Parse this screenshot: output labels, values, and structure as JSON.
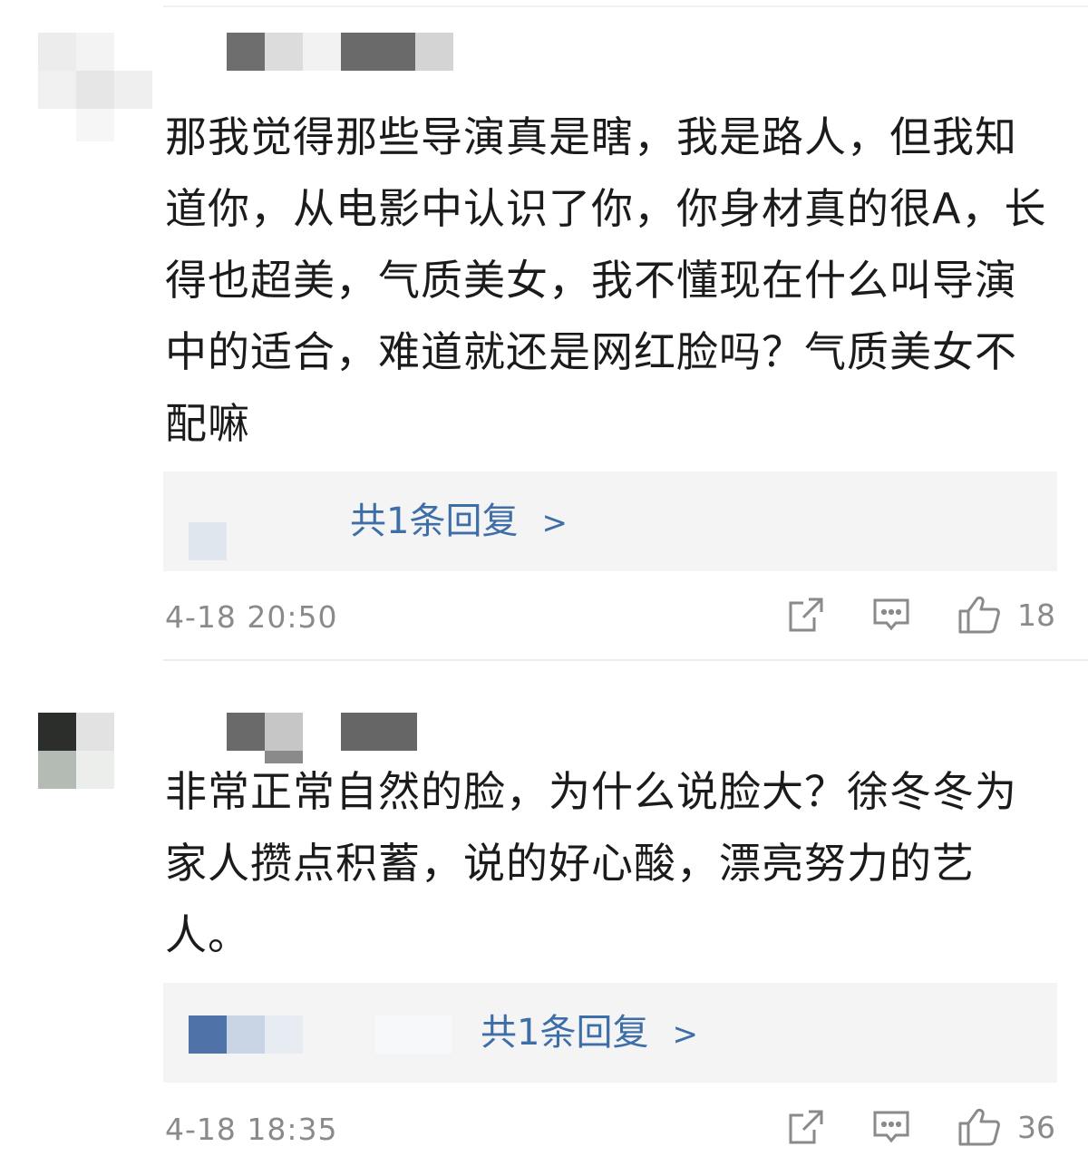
{
  "comments": [
    {
      "text": "那我觉得那些导演真是瞎，我是路人，但我知道你，从电影中认识了你，你身材真的很A，长得也超美，气质美女，我不懂现在什么叫导演中的适合，难道就还是网红脸吗？气质美女不配嘛",
      "reply_label": "共1条回复",
      "reply_arrow": ">",
      "time": "4-18 20:50",
      "likes": "18"
    },
    {
      "text": "非常正常自然的脸，为什么说脸大？徐冬冬为家人攒点积蓄，说的好心酸，漂亮努力的艺人。",
      "reply_label": "共1条回复",
      "reply_arrow": ">",
      "time": "4-18 18:35",
      "likes": "36"
    }
  ],
  "icons": {
    "share": "share-icon",
    "comment": "comment-icon",
    "like": "thumbs-up-icon"
  },
  "colors": {
    "reply_link": "#3d6ea8",
    "meta_text": "#8a8a8a",
    "reply_bg": "#f4f4f4"
  }
}
